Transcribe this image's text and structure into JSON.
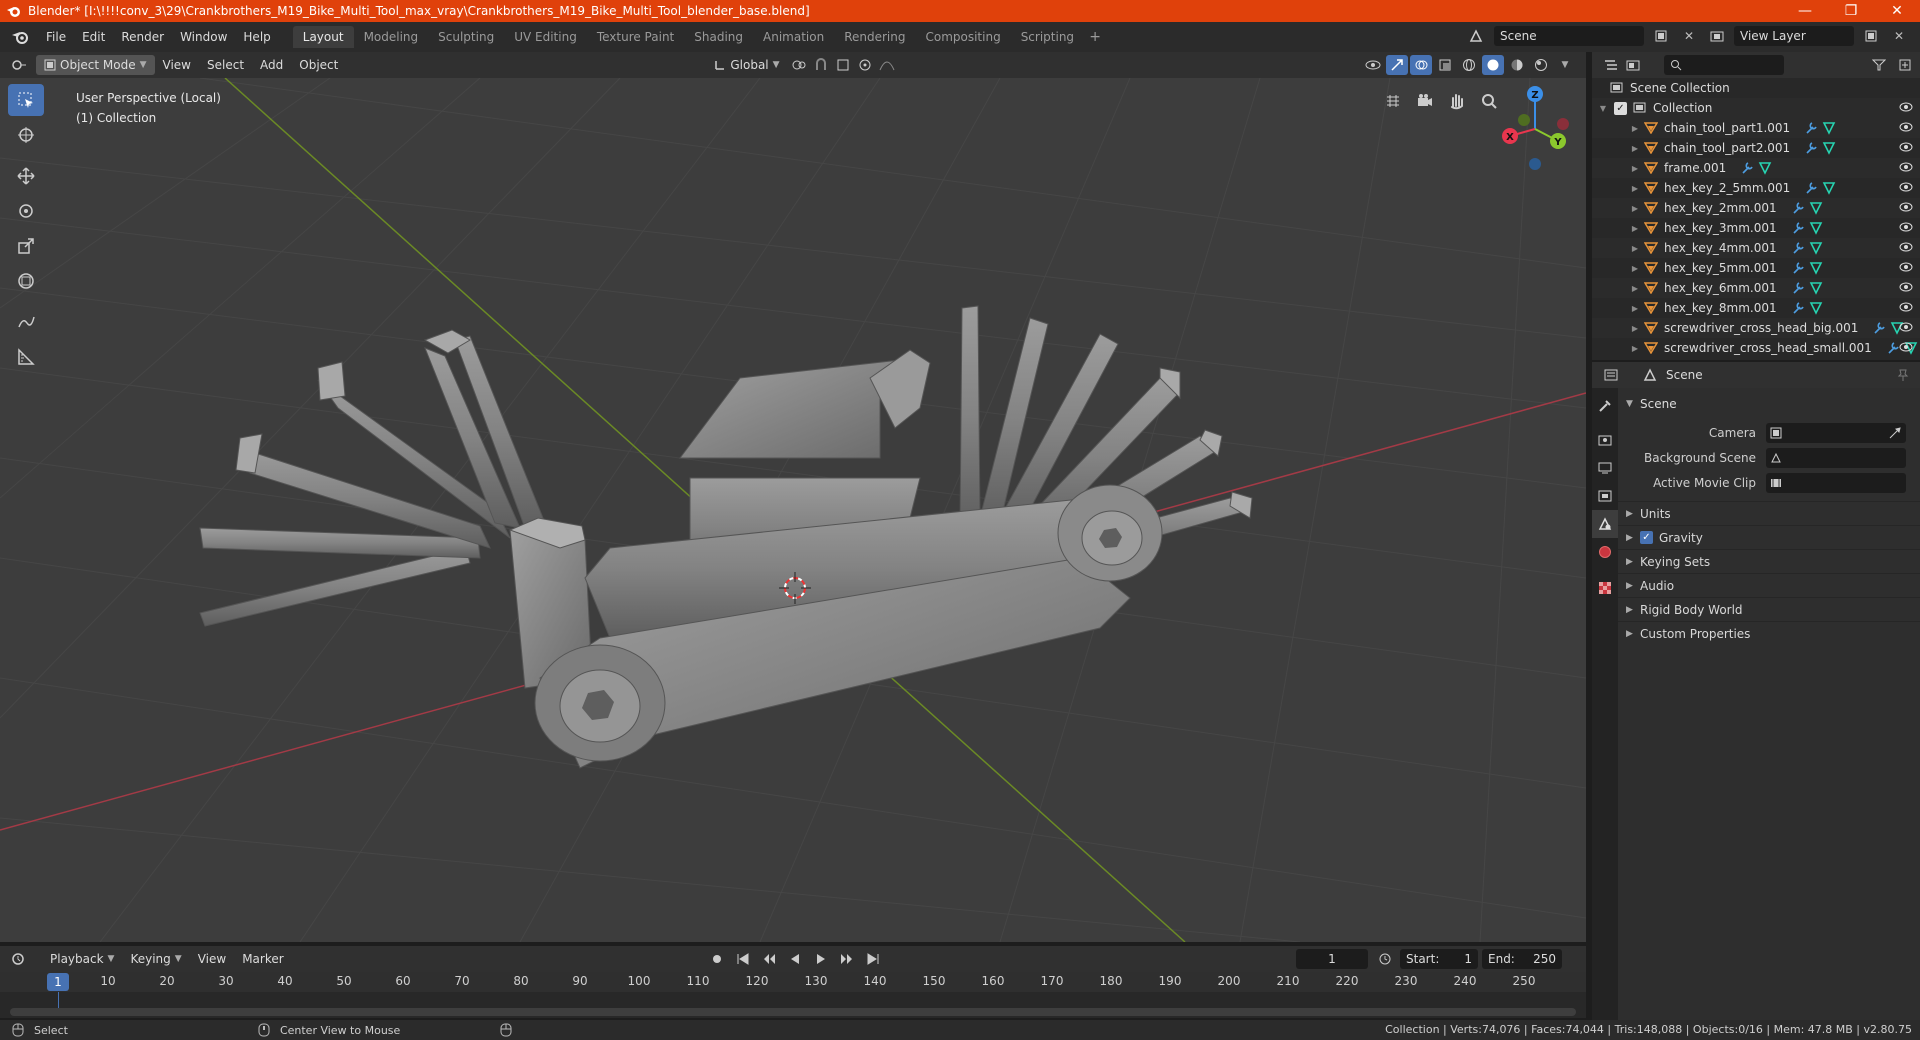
{
  "window": {
    "title": "Blender* [I:\\!!!!conv_3\\29\\Crankbrothers_M19_Bike_Multi_Tool_max_vray\\Crankbrothers_M19_Bike_Multi_Tool_blender_base.blend]",
    "minimize": "—",
    "maximize": "❐",
    "close": "✕"
  },
  "menu": [
    "File",
    "Edit",
    "Render",
    "Window",
    "Help"
  ],
  "workspaces": [
    "Layout",
    "Modeling",
    "Sculpting",
    "UV Editing",
    "Texture Paint",
    "Shading",
    "Animation",
    "Rendering",
    "Compositing",
    "Scripting"
  ],
  "active_workspace": "Layout",
  "scene_field": "Scene",
  "view_layer_field": "View Layer",
  "viewport_header": {
    "mode": "Object Mode",
    "menus": [
      "View",
      "Select",
      "Add",
      "Object"
    ],
    "transform_orientation": "Global"
  },
  "viewport": {
    "perspective": "User Perspective (Local)",
    "collection": "(1) Collection",
    "axis_x": "X",
    "axis_y": "Y",
    "axis_z": "Z"
  },
  "outliner": {
    "scene_collection": "Scene Collection",
    "collection": "Collection",
    "objects": [
      "chain_tool_part1.001",
      "chain_tool_part2.001",
      "frame.001",
      "hex_key_2_5mm.001",
      "hex_key_2mm.001",
      "hex_key_3mm.001",
      "hex_key_4mm.001",
      "hex_key_5mm.001",
      "hex_key_6mm.001",
      "hex_key_8mm.001",
      "screwdriver_cross_head_big.001",
      "screwdriver_cross_head_small.001"
    ]
  },
  "properties": {
    "context": "Scene",
    "panel_title": "Scene",
    "camera_label": "Camera",
    "background_scene_label": "Background Scene",
    "active_movie_clip_label": "Active Movie Clip",
    "subpanels": [
      "Units",
      "Gravity",
      "Keying Sets",
      "Audio",
      "Rigid Body World",
      "Custom Properties"
    ],
    "gravity_checked": true
  },
  "timeline": {
    "menus": [
      "Playback",
      "Keying",
      "View",
      "Marker"
    ],
    "current_frame": "1",
    "start_label": "Start:",
    "start": "1",
    "end_label": "End:",
    "end": "250",
    "ruler": [
      "10",
      "20",
      "30",
      "40",
      "50",
      "60",
      "70",
      "80",
      "90",
      "100",
      "110",
      "120",
      "130",
      "140",
      "150",
      "160",
      "170",
      "180",
      "190",
      "200",
      "210",
      "220",
      "230",
      "240",
      "250"
    ]
  },
  "statusbar": {
    "select": "Select",
    "center_view": "Center View to Mouse",
    "stats": "Collection | Verts:74,076 | Faces:74,044 | Tris:148,088 | Objects:0/16 | Mem: 47.8 MB | v2.80.75"
  },
  "colors": {
    "titlebar": "#e0410b",
    "accent": "#4772b3",
    "x_axis": "#e8364e",
    "y_axis": "#8bc82d",
    "z_axis": "#3b8fe8",
    "object_icon": "#e8943a",
    "modifier_icon": "#4d9de0",
    "mesh_icon": "#27d3b1"
  }
}
